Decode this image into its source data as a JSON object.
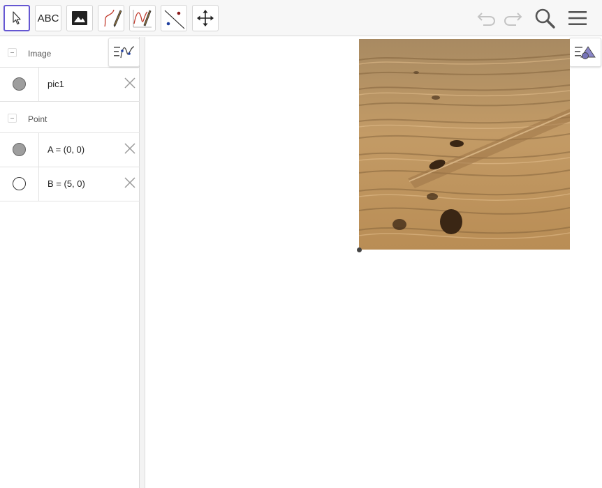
{
  "toolbar": {
    "tools": [
      {
        "name": "Move",
        "icon": "pointer-icon",
        "active": true
      },
      {
        "name": "Text",
        "label": "ABC",
        "icon": "text-tool-icon"
      },
      {
        "name": "Image",
        "icon": "image-icon"
      },
      {
        "name": "Pen",
        "icon": "pen-icon"
      },
      {
        "name": "Function Inspector",
        "icon": "function-pen-icon"
      },
      {
        "name": "Line",
        "icon": "line-icon"
      },
      {
        "name": "Move Graphics View",
        "icon": "move-view-icon"
      }
    ],
    "right_buttons": [
      "undo-icon",
      "redo-icon",
      "search-icon",
      "menu-icon"
    ]
  },
  "algebra": {
    "groups": [
      {
        "label": "Image",
        "items": [
          {
            "text": "pic1",
            "marble": "filled"
          }
        ]
      },
      {
        "label": "Point",
        "items": [
          {
            "text": "A = (0, 0)",
            "marble": "filled"
          },
          {
            "text": "B = (5, 0)",
            "marble": "empty"
          }
        ]
      }
    ]
  },
  "colors": {
    "accent": "#6557d2",
    "marble_fill": "#9e9e9e",
    "toolbar_bg": "#f7f7f7"
  },
  "graphics": {
    "image_subject": "sand-dunes-with-footprints-and-tire-tracks"
  }
}
